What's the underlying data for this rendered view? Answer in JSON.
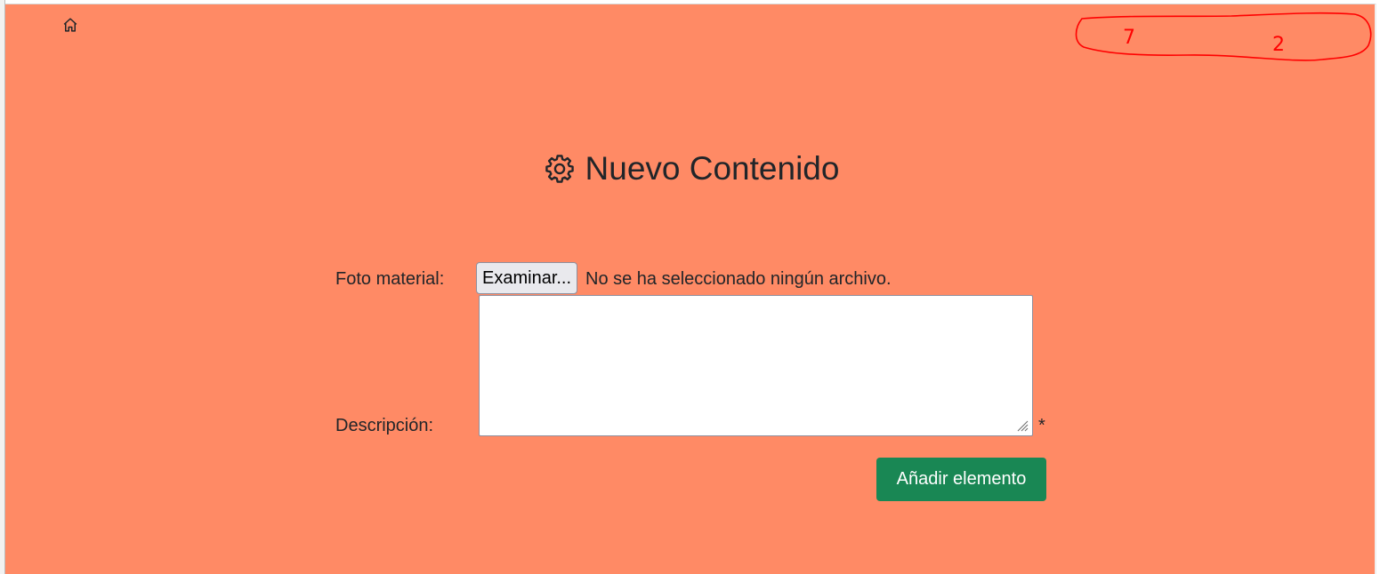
{
  "nav": {
    "home_icon": "house-icon"
  },
  "header": {
    "title": "Nuevo Contenido",
    "title_icon": "gear-icon"
  },
  "form": {
    "photo_label": "Foto material:",
    "file_button_label": "Examinar...",
    "file_status": "No se ha seleccionado ningún archivo.",
    "description_label": "Descripción:",
    "description_value": "",
    "required_marker": "*",
    "submit_label": "Añadir elemento"
  },
  "annotation": {
    "left_mark": "7",
    "right_mark": "2"
  },
  "colors": {
    "background": "#ff8a65",
    "submit_button": "#198754",
    "scribble": "#ff0000"
  }
}
